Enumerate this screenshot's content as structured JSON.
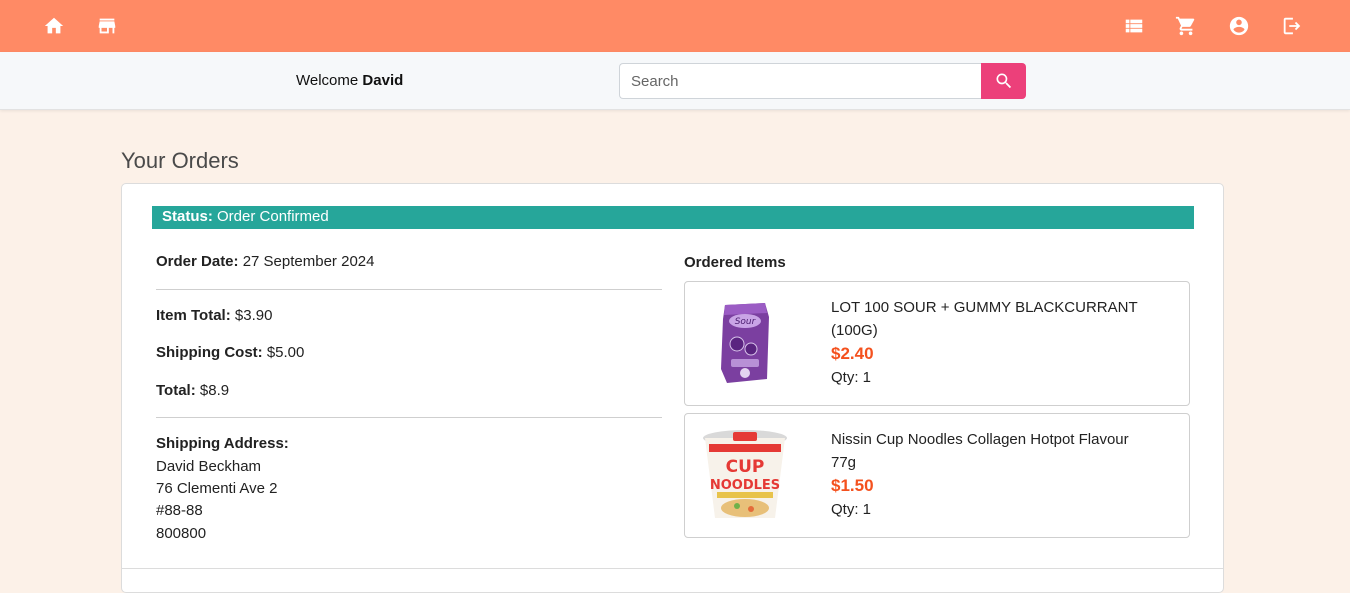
{
  "nav": {
    "home_icon": "home-icon",
    "store_icon": "store-icon",
    "orders_icon": "list-icon",
    "cart_icon": "cart-icon",
    "account_icon": "account-circle-icon",
    "logout_icon": "logout-icon"
  },
  "header": {
    "welcome_prefix": "Welcome",
    "user_name": "David",
    "search_placeholder": "Search",
    "search_value": ""
  },
  "page": {
    "title": "Your Orders"
  },
  "order": {
    "status_label": "Status:",
    "status_value": "Order Confirmed",
    "date_label": "Order Date:",
    "date_value": "27 September 2024",
    "item_total_label": "Item Total:",
    "item_total_value": "$3.90",
    "shipping_label": "Shipping Cost:",
    "shipping_value": "$5.00",
    "total_label": "Total:",
    "total_value": "$8.9",
    "address_label": "Shipping Address:",
    "address_lines": [
      "David Beckham",
      "76 Clementi Ave 2",
      "#88-88",
      "800800"
    ],
    "items_title": "Ordered Items",
    "items": [
      {
        "name_line1": "LOT 100 SOUR + GUMMY BLACKCURRANT",
        "name_line2": "(100G)",
        "price": "$2.40",
        "qty": "Qty: 1",
        "image": "gummy-pack-image"
      },
      {
        "name_line1": "Nissin Cup Noodles Collagen Hotpot Flavour",
        "name_line2": "77g",
        "price": "$1.50",
        "qty": "Qty: 1",
        "image": "cup-noodles-image"
      }
    ]
  },
  "colors": {
    "topbar": "#ff8a65",
    "status": "#26a69a",
    "search_button": "#ec407a",
    "price": "#f4511e",
    "background": "#fcf1e8"
  }
}
